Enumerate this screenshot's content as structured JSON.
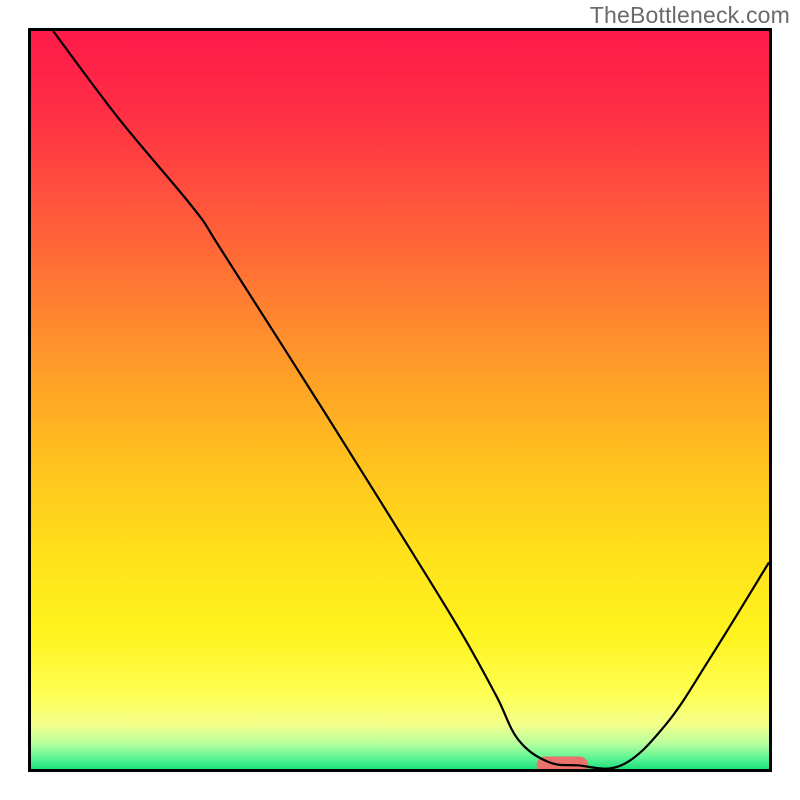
{
  "watermark": "TheBottleneck.com",
  "chart_data": {
    "type": "line",
    "title": "",
    "xlabel": "",
    "ylabel": "",
    "xlim": [
      0,
      100
    ],
    "ylim": [
      0,
      100
    ],
    "grid": false,
    "legend": false,
    "background_gradient": {
      "stops": [
        {
          "offset": 0.0,
          "color": "#ff1a4a"
        },
        {
          "offset": 0.1,
          "color": "#ff2c45"
        },
        {
          "offset": 0.25,
          "color": "#ff593b"
        },
        {
          "offset": 0.4,
          "color": "#ff8a2e"
        },
        {
          "offset": 0.55,
          "color": "#ffb820"
        },
        {
          "offset": 0.7,
          "color": "#ffdf1a"
        },
        {
          "offset": 0.82,
          "color": "#fff41f"
        },
        {
          "offset": 0.9,
          "color": "#ffff55"
        },
        {
          "offset": 0.94,
          "color": "#f3ff8a"
        },
        {
          "offset": 0.965,
          "color": "#b9ff9c"
        },
        {
          "offset": 0.985,
          "color": "#5ef596"
        },
        {
          "offset": 1.0,
          "color": "#1be07a"
        }
      ]
    },
    "series": [
      {
        "name": "bottleneck-curve",
        "color": "#000000",
        "stroke_width": 2.2,
        "x": [
          3,
          12,
          22,
          26,
          40,
          50,
          58,
          63,
          66,
          70,
          74,
          80,
          86,
          92,
          100
        ],
        "y": [
          100,
          88,
          76,
          70,
          48,
          32,
          19,
          10,
          4,
          1,
          0.5,
          0.5,
          6,
          15,
          28
        ]
      }
    ],
    "markers": [
      {
        "name": "minimum-pill",
        "shape": "capsule",
        "x_center": 72,
        "y_center": 0.5,
        "width_x": 7,
        "height_y": 2.4,
        "fill": "#e9736b"
      }
    ]
  }
}
